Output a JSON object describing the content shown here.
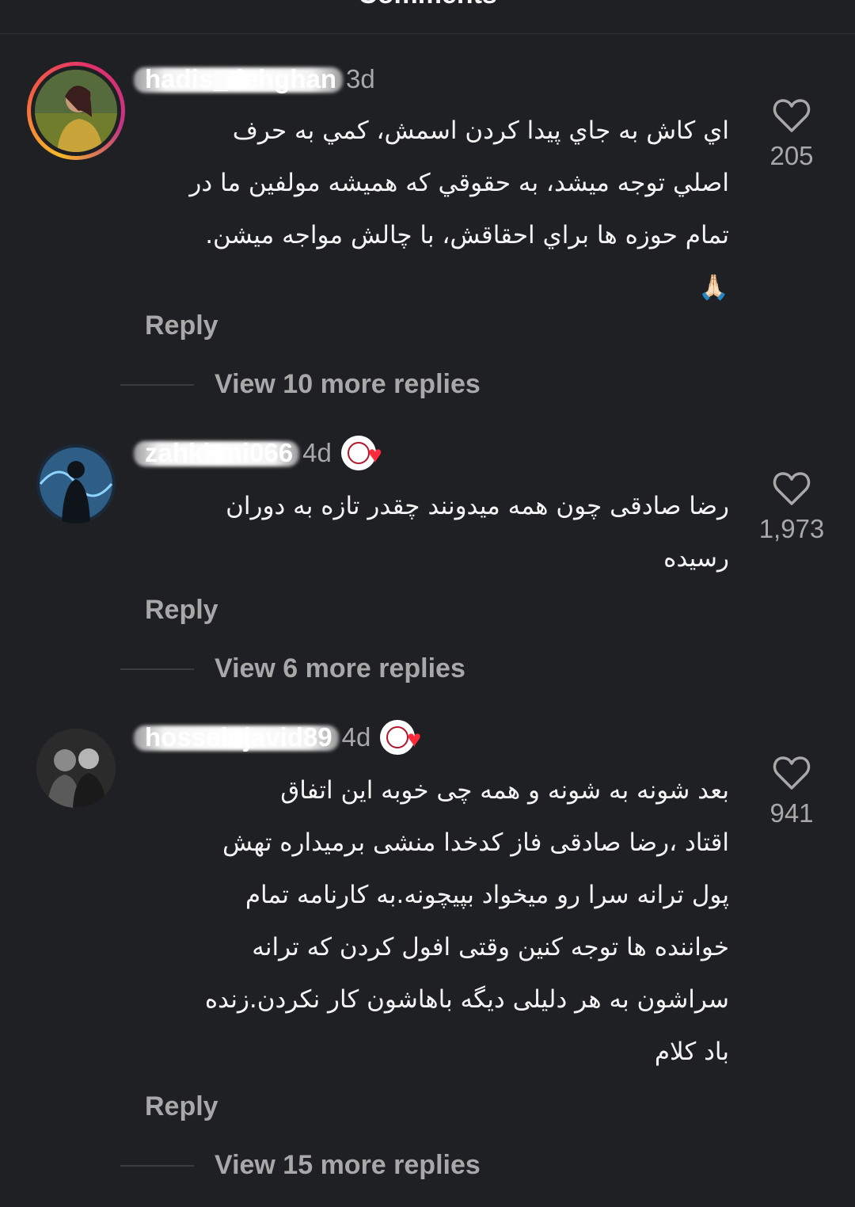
{
  "header": {
    "title": "Comments"
  },
  "comments": [
    {
      "username": "hadis_dehghan",
      "time": "3d",
      "text_lines": [
        "اي كاش به جاي پيدا كردن اسمش، كمي به حرف",
        "اصلي توجه ميشد، به حقوقي كه هميشه مولفين ما در",
        "تمام حوزه ها براي احقاقش، با چالش مواجه ميشن."
      ],
      "emoji": "🙏🏻",
      "likes": "205",
      "reply_label": "Reply",
      "view_more": "View 10 more replies"
    },
    {
      "username": "zahkhmi066",
      "time": "4d",
      "text_lines": [
        "رضا صادقی چون همه میدونند چقدر تازه به دوران",
        "رسیده"
      ],
      "likes": "1,973",
      "reply_label": "Reply",
      "view_more": "View 6 more replies"
    },
    {
      "username": "hosseinjavid89",
      "time": "4d",
      "text_lines": [
        "بعد شونه به شونه و همه چی خوبه این اتفاق",
        "اقتاد ،رضا صادقی فاز کدخدا منشی برمیداره تهش",
        "پول ترانه سرا رو میخواد بپیچونه.به کارنامه تمام",
        "خواننده ها توجه کنین وقتی افول کردن که ترانه",
        "سراشون به هر دلیلی دیگه باهاشون کار نکردن.زنده",
        "باد کلام"
      ],
      "likes": "941",
      "reply_label": "Reply",
      "view_more": "View 15 more replies"
    }
  ],
  "icons": {
    "like": "heart-outline-icon",
    "badge": "verified-fan-badge-icon"
  }
}
